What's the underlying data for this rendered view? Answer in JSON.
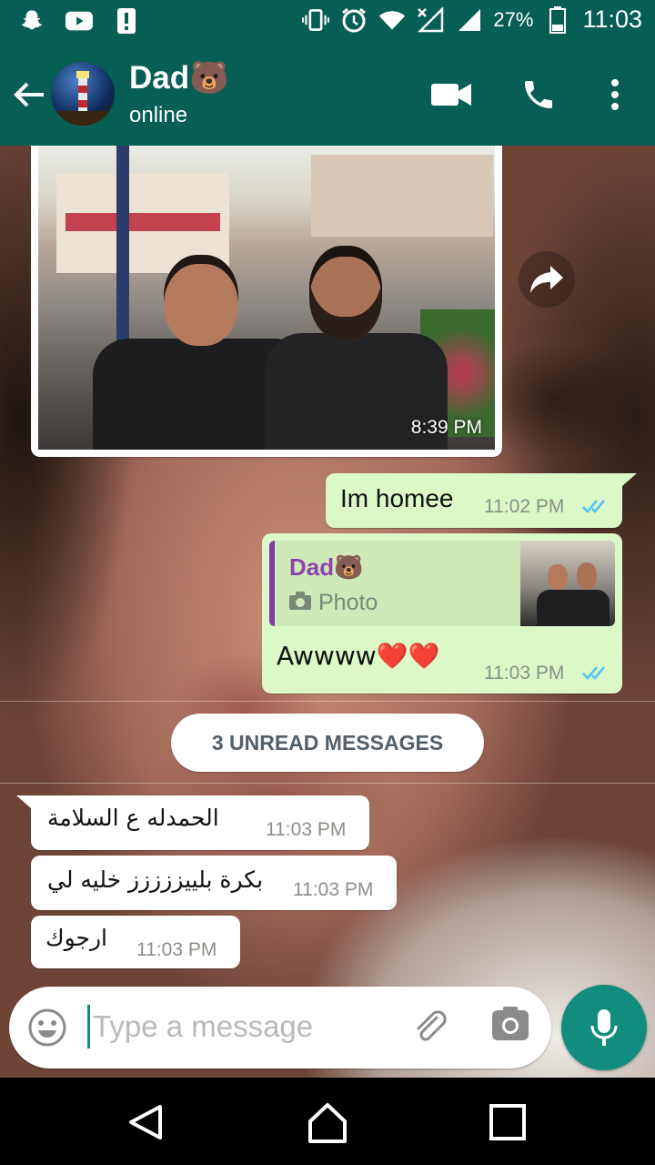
{
  "status_bar": {
    "battery": "27%",
    "time": "11:03"
  },
  "header": {
    "contact_name": "Dad🐻",
    "status": "online"
  },
  "messages": {
    "photo": {
      "time": "8:39 PM"
    },
    "m1": {
      "text": "Im homee",
      "time": "11:02 PM"
    },
    "m2": {
      "quote_name": "Dad🐻",
      "quote_type": "Photo",
      "text": "Awwww❤️❤️",
      "time": "11:03 PM"
    },
    "unread_label": "3 UNREAD MESSAGES",
    "m3": {
      "text": "الحمدله ع السلامة",
      "time": "11:03 PM"
    },
    "m4": {
      "text": "بكرة بلييززززز خليه لي",
      "time": "11:03 PM"
    },
    "m5": {
      "text": "ارجوك",
      "time": "11:03 PM"
    }
  },
  "composer": {
    "placeholder": "Type a message"
  },
  "colors": {
    "header": "#075e54",
    "outgoing_bubble": "#dcf8c6",
    "incoming_bubble": "#ffffff",
    "mic_button": "#128c7e",
    "read_ticks": "#4fc3f7"
  }
}
